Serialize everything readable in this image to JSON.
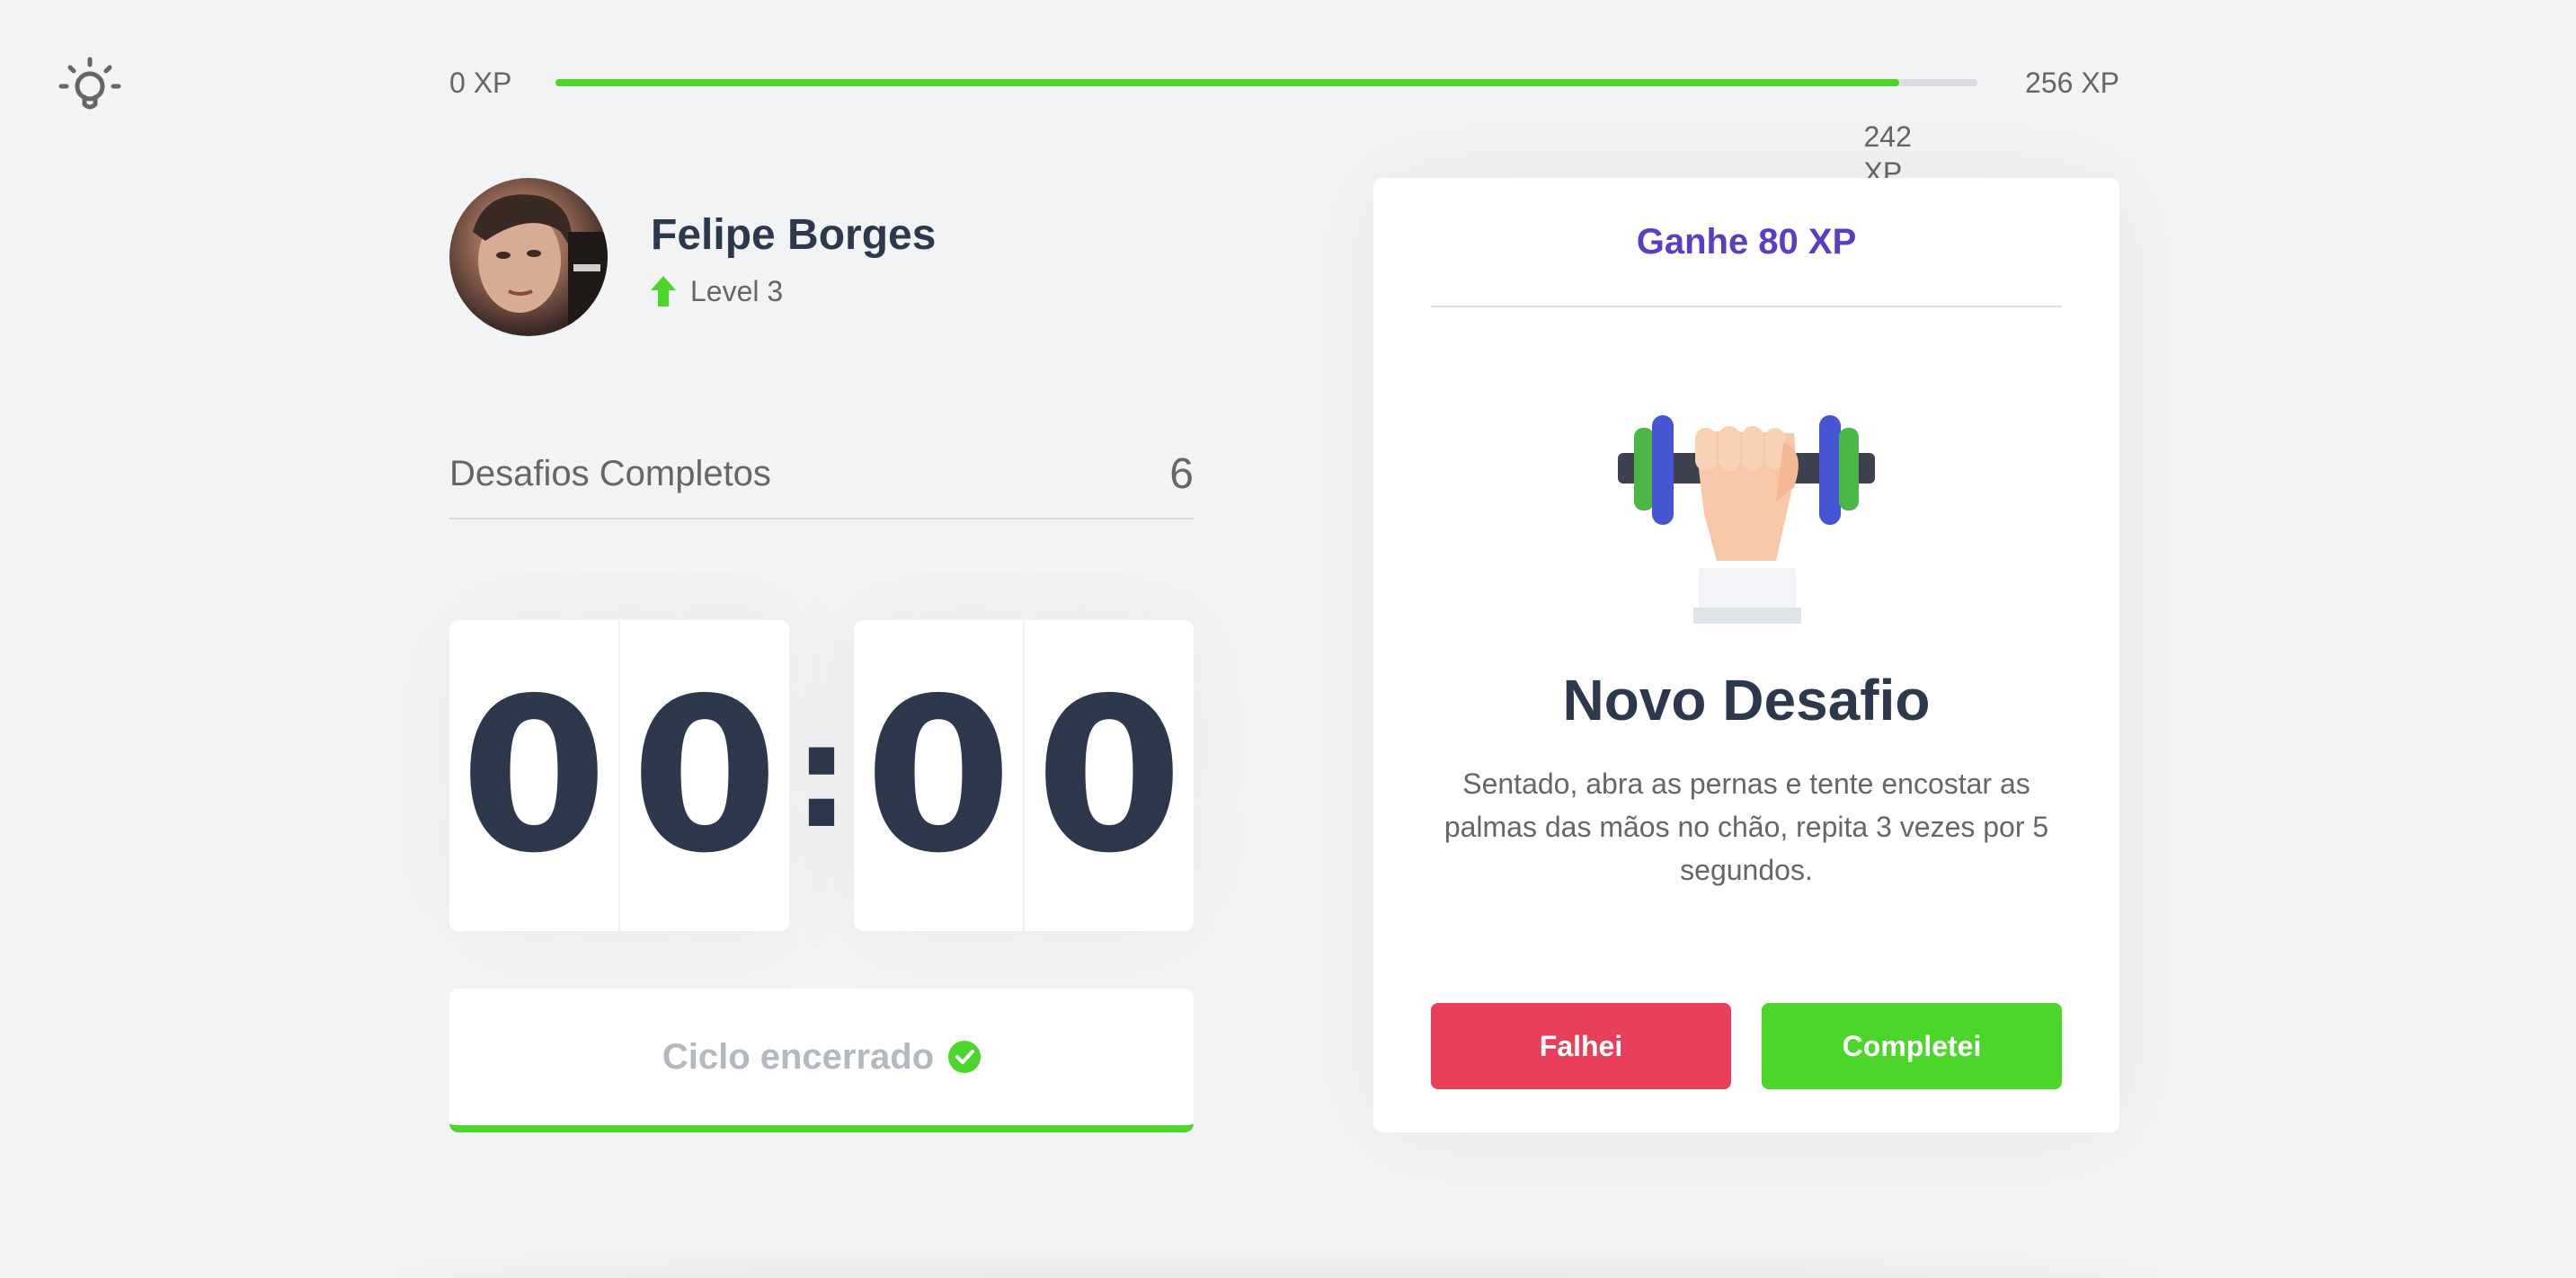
{
  "theme": {
    "icon": "lightbulb-icon",
    "accent": "#4cd62b",
    "danger": "#e83f5b",
    "title_color": "#2e384d",
    "highlight": "#5b3cc4"
  },
  "xp_bar": {
    "min_label": "0 XP",
    "max_label": "256 XP",
    "current_label": "242 XP",
    "current": 242,
    "max": 256
  },
  "profile": {
    "name": "Felipe Borges",
    "level_label": "Level 3",
    "level_icon": "level-up-arrow-icon"
  },
  "challenges": {
    "label": "Desafios Completos",
    "count": "6"
  },
  "countdown": {
    "minute_left": "0",
    "minute_right": "0",
    "separator": ":",
    "second_left": "0",
    "second_right": "0"
  },
  "cycle_button": {
    "label": "Ciclo encerrado",
    "icon": "check-circle-icon"
  },
  "challenge_box": {
    "reward": "Ganhe 80 XP",
    "illustration": "dumbbell-hand-icon",
    "title": "Novo Desafio",
    "description": "Sentado, abra as pernas e tente encostar as palmas das mãos no chão, repita 3 vezes por 5 segundos.",
    "failed_label": "Falhei",
    "succeeded_label": "Completei"
  }
}
